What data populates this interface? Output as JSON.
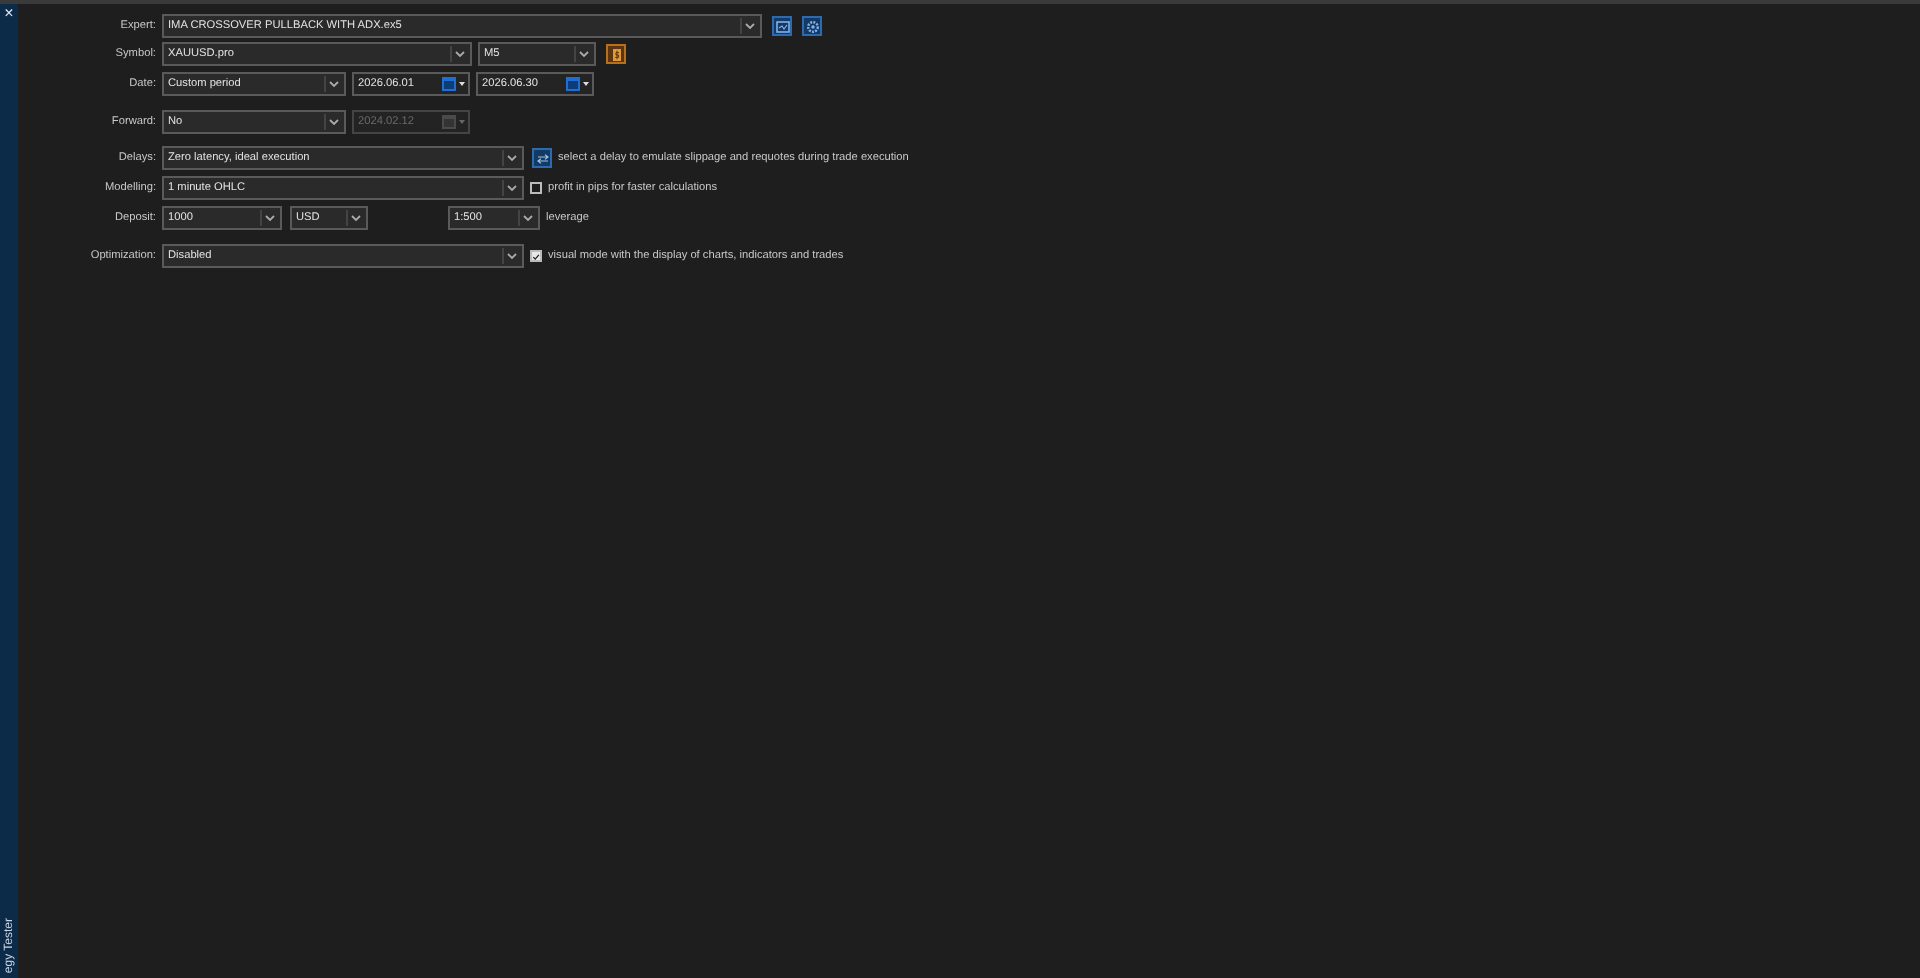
{
  "sidebar": {
    "close": "×",
    "title": "egy Tester"
  },
  "rows": [
    {
      "label": "Expert:",
      "controls": [
        {
          "kind": "combo",
          "value": "IMA CROSSOVER PULLBACK WITH ADX.ex5"
        },
        {
          "kind": "chart-button"
        },
        {
          "kind": "settings-button"
        }
      ]
    },
    {
      "label": "Symbol:",
      "controls": [
        {
          "kind": "combo",
          "value": "XAUUSD.pro"
        },
        {
          "kind": "combo",
          "value": "M5"
        },
        {
          "kind": "symbol-button"
        }
      ]
    },
    {
      "label": "Date:",
      "controls": [
        {
          "kind": "combo",
          "value": "Custom period"
        },
        {
          "kind": "date",
          "value": "2026.06.01",
          "disabled": false
        },
        {
          "kind": "date",
          "value": "2026.06.30",
          "disabled": false
        }
      ]
    },
    {
      "label": "Forward:",
      "controls": [
        {
          "kind": "combo",
          "value": "No"
        },
        {
          "kind": "date",
          "value": "2024.02.12",
          "disabled": true
        }
      ]
    },
    {
      "label": "Delays:",
      "controls": [
        {
          "kind": "combo",
          "value": "Zero latency, ideal execution"
        },
        {
          "kind": "delay-button"
        },
        {
          "kind": "note",
          "text": "select a delay to emulate slippage and requotes during trade execution"
        }
      ]
    },
    {
      "label": "Modelling:",
      "controls": [
        {
          "kind": "combo",
          "value": "1 minute OHLC"
        },
        {
          "kind": "checkbox",
          "checked": false,
          "text": "profit in pips for faster calculations"
        }
      ]
    },
    {
      "label": "Deposit:",
      "controls": [
        {
          "kind": "combo",
          "value": "1000"
        },
        {
          "kind": "combo",
          "value": "USD"
        },
        {
          "kind": "combo",
          "value": "1:500"
        },
        {
          "kind": "note",
          "text": "leverage"
        }
      ]
    },
    {
      "label": "Optimization:",
      "controls": [
        {
          "kind": "combo",
          "value": "Disabled"
        },
        {
          "kind": "checkbox",
          "checked": true,
          "text": "visual mode with the display of charts, indicators and trades"
        }
      ]
    }
  ]
}
